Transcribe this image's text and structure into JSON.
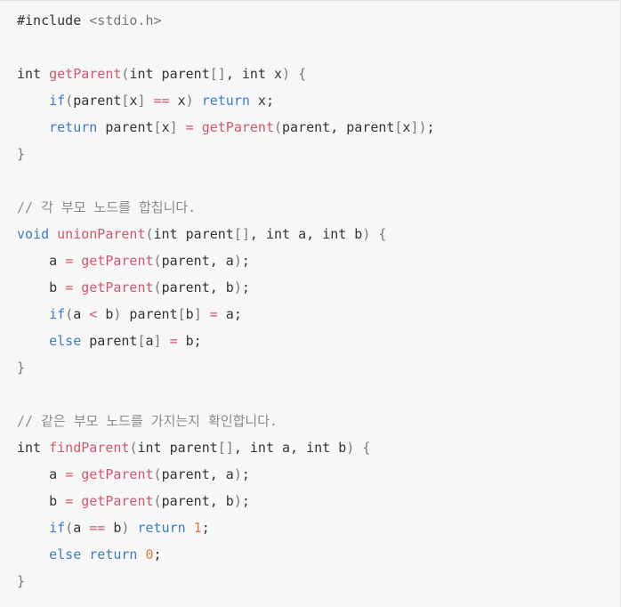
{
  "code": {
    "language": "c",
    "colors": {
      "background": "#f7f7f7",
      "plain": "#333333",
      "keyword": "#3b7cc8",
      "function": "#d2566b",
      "operator": "#d2566b",
      "number": "#e07a3f",
      "comment": "#8a8a8a",
      "punctuation": "#777777"
    },
    "lines": [
      [
        [
          "plain",
          "#include "
        ],
        [
          "include",
          "<stdio.h>"
        ]
      ],
      [],
      [
        [
          "plain",
          "int "
        ],
        [
          "func",
          "getParent"
        ],
        [
          "punc",
          "("
        ],
        [
          "plain",
          "int parent"
        ],
        [
          "punc",
          "[]"
        ],
        [
          "plain",
          ", int x"
        ],
        [
          "punc",
          ")"
        ],
        [
          "plain",
          " "
        ],
        [
          "punc",
          "{"
        ]
      ],
      [
        [
          "plain",
          "    "
        ],
        [
          "keyword",
          "if"
        ],
        [
          "punc",
          "("
        ],
        [
          "plain",
          "parent"
        ],
        [
          "punc",
          "["
        ],
        [
          "plain",
          "x"
        ],
        [
          "punc",
          "]"
        ],
        [
          "plain",
          " "
        ],
        [
          "op",
          "=="
        ],
        [
          "plain",
          " x"
        ],
        [
          "punc",
          ")"
        ],
        [
          "plain",
          " "
        ],
        [
          "keyword",
          "return"
        ],
        [
          "plain",
          " x;"
        ]
      ],
      [
        [
          "plain",
          "    "
        ],
        [
          "keyword",
          "return"
        ],
        [
          "plain",
          " parent"
        ],
        [
          "punc",
          "["
        ],
        [
          "plain",
          "x"
        ],
        [
          "punc",
          "]"
        ],
        [
          "plain",
          " "
        ],
        [
          "op",
          "="
        ],
        [
          "plain",
          " "
        ],
        [
          "func",
          "getParent"
        ],
        [
          "punc",
          "("
        ],
        [
          "plain",
          "parent, parent"
        ],
        [
          "punc",
          "["
        ],
        [
          "plain",
          "x"
        ],
        [
          "punc",
          "])"
        ],
        [
          "plain",
          ";"
        ]
      ],
      [
        [
          "punc",
          "}"
        ]
      ],
      [],
      [
        [
          "comment",
          "// 각 부모 노드를 합칩니다."
        ]
      ],
      [
        [
          "keyword",
          "void"
        ],
        [
          "plain",
          " "
        ],
        [
          "func",
          "unionParent"
        ],
        [
          "punc",
          "("
        ],
        [
          "plain",
          "int parent"
        ],
        [
          "punc",
          "[]"
        ],
        [
          "plain",
          ", int a, int b"
        ],
        [
          "punc",
          ")"
        ],
        [
          "plain",
          " "
        ],
        [
          "punc",
          "{"
        ]
      ],
      [
        [
          "plain",
          "    a "
        ],
        [
          "op",
          "="
        ],
        [
          "plain",
          " "
        ],
        [
          "func",
          "getParent"
        ],
        [
          "punc",
          "("
        ],
        [
          "plain",
          "parent, a"
        ],
        [
          "punc",
          ")"
        ],
        [
          "plain",
          ";"
        ]
      ],
      [
        [
          "plain",
          "    b "
        ],
        [
          "op",
          "="
        ],
        [
          "plain",
          " "
        ],
        [
          "func",
          "getParent"
        ],
        [
          "punc",
          "("
        ],
        [
          "plain",
          "parent, b"
        ],
        [
          "punc",
          ")"
        ],
        [
          "plain",
          ";"
        ]
      ],
      [
        [
          "plain",
          "    "
        ],
        [
          "keyword",
          "if"
        ],
        [
          "punc",
          "("
        ],
        [
          "plain",
          "a "
        ],
        [
          "op",
          "<"
        ],
        [
          "plain",
          " b"
        ],
        [
          "punc",
          ")"
        ],
        [
          "plain",
          " parent"
        ],
        [
          "punc",
          "["
        ],
        [
          "plain",
          "b"
        ],
        [
          "punc",
          "]"
        ],
        [
          "plain",
          " "
        ],
        [
          "op",
          "="
        ],
        [
          "plain",
          " a;"
        ]
      ],
      [
        [
          "plain",
          "    "
        ],
        [
          "keyword",
          "else"
        ],
        [
          "plain",
          " parent"
        ],
        [
          "punc",
          "["
        ],
        [
          "plain",
          "a"
        ],
        [
          "punc",
          "]"
        ],
        [
          "plain",
          " "
        ],
        [
          "op",
          "="
        ],
        [
          "plain",
          " b;"
        ]
      ],
      [
        [
          "punc",
          "}"
        ]
      ],
      [],
      [
        [
          "comment",
          "// 같은 부모 노드를 가지는지 확인합니다."
        ]
      ],
      [
        [
          "plain",
          "int "
        ],
        [
          "func",
          "findParent"
        ],
        [
          "punc",
          "("
        ],
        [
          "plain",
          "int parent"
        ],
        [
          "punc",
          "[]"
        ],
        [
          "plain",
          ", int a, int b"
        ],
        [
          "punc",
          ")"
        ],
        [
          "plain",
          " "
        ],
        [
          "punc",
          "{"
        ]
      ],
      [
        [
          "plain",
          "    a "
        ],
        [
          "op",
          "="
        ],
        [
          "plain",
          " "
        ],
        [
          "func",
          "getParent"
        ],
        [
          "punc",
          "("
        ],
        [
          "plain",
          "parent, a"
        ],
        [
          "punc",
          ")"
        ],
        [
          "plain",
          ";"
        ]
      ],
      [
        [
          "plain",
          "    b "
        ],
        [
          "op",
          "="
        ],
        [
          "plain",
          " "
        ],
        [
          "func",
          "getParent"
        ],
        [
          "punc",
          "("
        ],
        [
          "plain",
          "parent, b"
        ],
        [
          "punc",
          ")"
        ],
        [
          "plain",
          ";"
        ]
      ],
      [
        [
          "plain",
          "    "
        ],
        [
          "keyword",
          "if"
        ],
        [
          "punc",
          "("
        ],
        [
          "plain",
          "a "
        ],
        [
          "op",
          "=="
        ],
        [
          "plain",
          " b"
        ],
        [
          "punc",
          ")"
        ],
        [
          "plain",
          " "
        ],
        [
          "keyword",
          "return"
        ],
        [
          "plain",
          " "
        ],
        [
          "number",
          "1"
        ],
        [
          "plain",
          ";"
        ]
      ],
      [
        [
          "plain",
          "    "
        ],
        [
          "keyword",
          "else"
        ],
        [
          "plain",
          " "
        ],
        [
          "keyword",
          "return"
        ],
        [
          "plain",
          " "
        ],
        [
          "number",
          "0"
        ],
        [
          "plain",
          ";"
        ]
      ],
      [
        [
          "punc",
          "}"
        ]
      ]
    ]
  }
}
